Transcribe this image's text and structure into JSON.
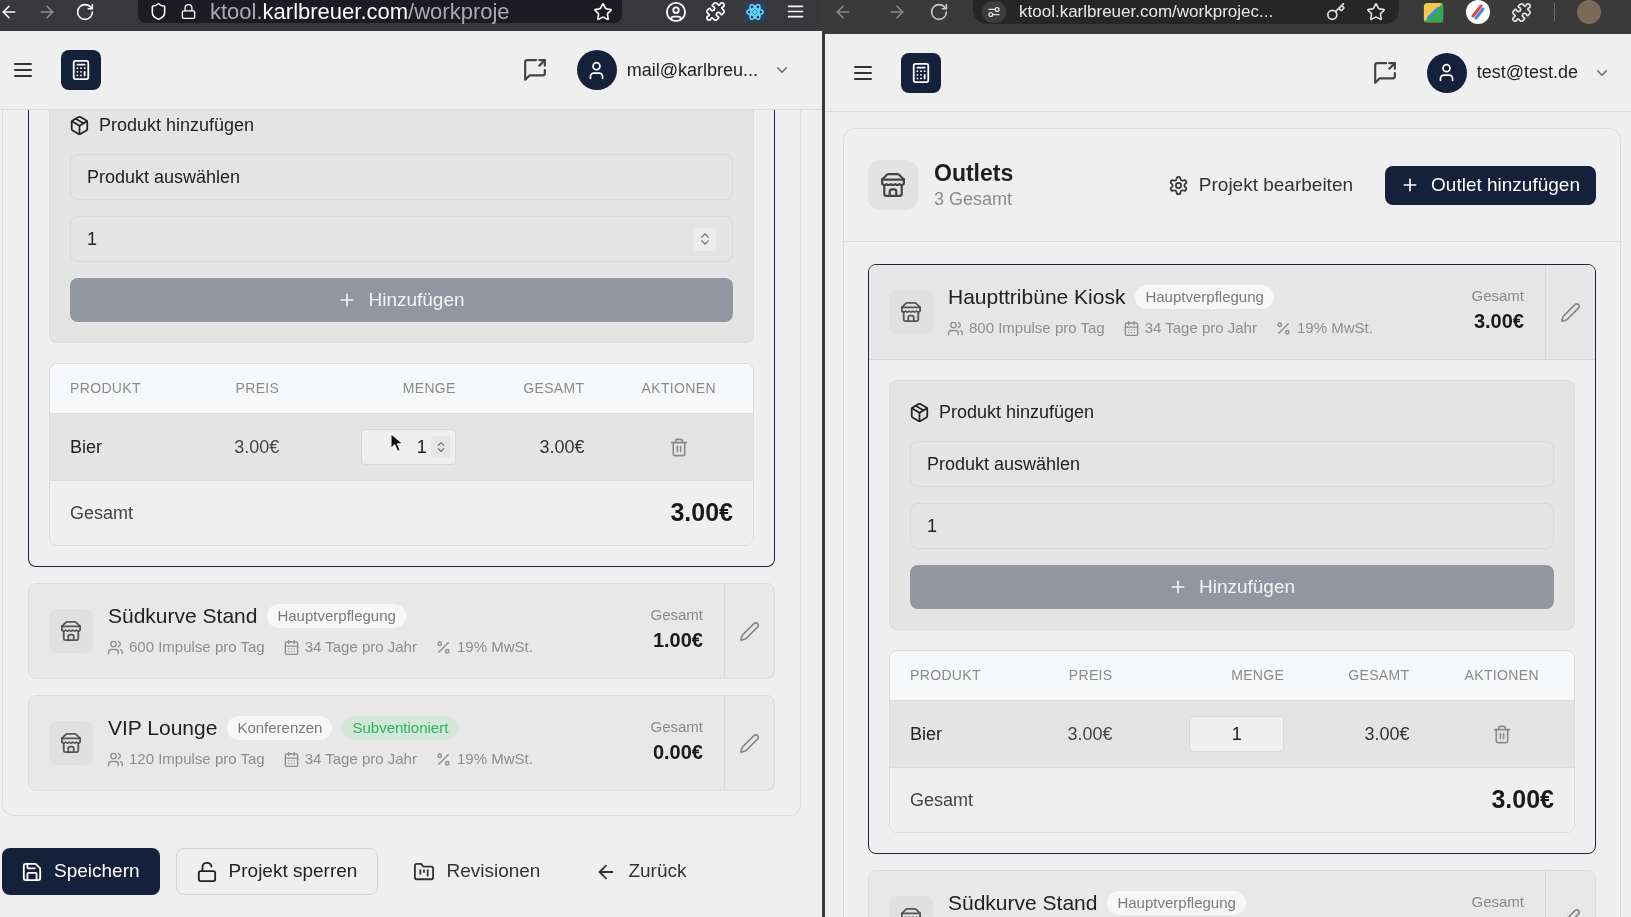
{
  "windows": [
    {
      "kind": "firefox",
      "url": "ktool.**karlbreuer.com**/workproje",
      "header": {
        "user": "mail@karlbreu..."
      },
      "outlets_panel": {
        "outlets": [
          {
            "expanded": true,
            "add_product": {
              "title": "Produkt hinzufügen",
              "product_select": "Produkt auswählen",
              "quantity": "1",
              "button": "Hinzufügen"
            },
            "table": {
              "columns": [
                "PRODUKT",
                "PREIS",
                "MENGE",
                "GESAMT",
                "AKTIONEN"
              ],
              "rows": [
                {
                  "product": "Bier",
                  "price": "3.00€",
                  "quantity": "1",
                  "total": "3.00€"
                }
              ],
              "footer": {
                "label": "Gesamt",
                "total": "3.00€"
              }
            }
          },
          {
            "expanded": false,
            "name": "Südkurve Stand",
            "tags": [
              {
                "label": "Hauptverpflegung",
                "kind": "category"
              }
            ],
            "meta": [
              {
                "kind": "impulses",
                "text": "600 Impulse pro Tag"
              },
              {
                "kind": "days",
                "text": "34 Tage pro Jahr"
              },
              {
                "kind": "vat",
                "text": "19% MwSt."
              }
            ],
            "total_label": "Gesamt",
            "total": "1.00€"
          },
          {
            "expanded": false,
            "name": "VIP Lounge",
            "tags": [
              {
                "label": "Konferenzen",
                "kind": "category"
              },
              {
                "label": "Subventioniert",
                "kind": "subsidy"
              }
            ],
            "meta": [
              {
                "kind": "impulses",
                "text": "120 Impulse pro Tag"
              },
              {
                "kind": "days",
                "text": "34 Tage pro Jahr"
              },
              {
                "kind": "vat",
                "text": "19% MwSt."
              }
            ],
            "total_label": "Gesamt",
            "total": "0.00€"
          }
        ]
      },
      "actions": [
        {
          "label": "Speichern",
          "kind": "primary"
        },
        {
          "label": "Projekt sperren",
          "kind": "outline"
        },
        {
          "label": "Revisionen",
          "kind": "ghost"
        },
        {
          "label": "Zurück",
          "kind": "ghost"
        }
      ]
    },
    {
      "kind": "chrome",
      "url": "ktool.karlbreuer.com/workprojec...",
      "header": {
        "user": "test@test.de"
      },
      "outlets_panel": {
        "title": "Outlets",
        "count": "3 Gesamt",
        "edit_button": "Projekt bearbeiten",
        "add_button": "Outlet hinzufügen",
        "outlets": [
          {
            "expanded": true,
            "name": "Haupttribüne Kiosk",
            "tags": [
              {
                "label": "Hauptverpflegung",
                "kind": "category"
              }
            ],
            "meta": [
              {
                "kind": "impulses",
                "text": "800 Impulse pro Tag"
              },
              {
                "kind": "days",
                "text": "34 Tage pro Jahr"
              },
              {
                "kind": "vat",
                "text": "19% MwSt."
              }
            ],
            "total_label": "Gesamt",
            "total": "3.00€",
            "add_product": {
              "title": "Produkt hinzufügen",
              "product_select": "Produkt auswählen",
              "quantity": "1",
              "button": "Hinzufügen"
            },
            "table": {
              "columns": [
                "PRODUKT",
                "PREIS",
                "MENGE",
                "GESAMT",
                "AKTIONEN"
              ],
              "rows": [
                {
                  "product": "Bier",
                  "price": "3.00€",
                  "quantity": "1",
                  "total": "3.00€"
                }
              ],
              "footer": {
                "label": "Gesamt",
                "total": "3.00€"
              }
            }
          },
          {
            "expanded": false,
            "name": "Südkurve Stand",
            "tags": [
              {
                "label": "Hauptverpflegung",
                "kind": "category"
              }
            ],
            "total_label": "Gesamt"
          }
        ]
      }
    }
  ]
}
